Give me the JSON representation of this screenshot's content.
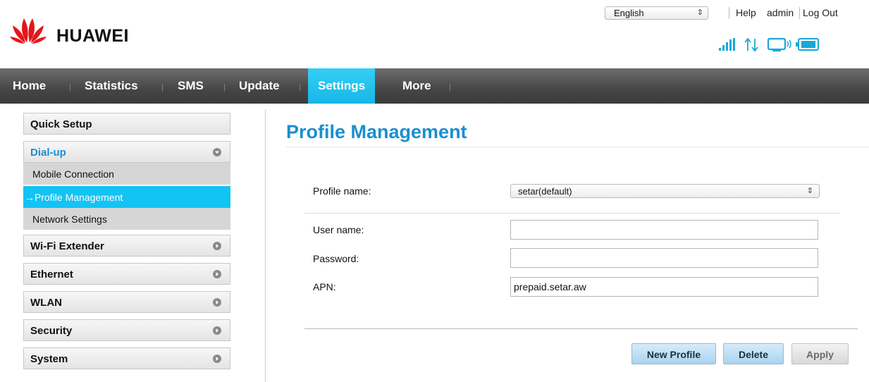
{
  "header": {
    "brand": "HUAWEI",
    "language": "English",
    "links": [
      "Help",
      "admin",
      "Log Out"
    ]
  },
  "icons": {
    "signal": "signal-strength-icon",
    "data": "data-transfer-arrows-icon",
    "wifi_device": "connected-device-icon",
    "battery": "battery-icon"
  },
  "nav": {
    "items": [
      "Home",
      "Statistics",
      "SMS",
      "Update",
      "Settings",
      "More"
    ],
    "active": "Settings"
  },
  "sidebar": {
    "quick_setup": "Quick Setup",
    "dialup": "Dial-up",
    "dialup_subitems": [
      "Mobile Connection",
      "→Profile Management",
      "Network Settings"
    ],
    "groups": [
      "Wi-Fi Extender",
      "Ethernet",
      "WLAN",
      "Security",
      "System"
    ]
  },
  "main": {
    "title": "Profile Management",
    "profile_name_label": "Profile name:",
    "profile_name_value": "setar(default)",
    "user_name_label": "User name:",
    "user_name_value": "",
    "password_label": "Password:",
    "password_value": "",
    "apn_label": "APN:",
    "apn_value": "prepaid.setar.aw"
  },
  "buttons": {
    "new_profile": "New Profile",
    "delete": "Delete",
    "apply": "Apply"
  },
  "colors": {
    "accent": "#18b6e6",
    "title": "#1a8fd0",
    "nav_bg": "#454545",
    "logo_red": "#e3161b"
  }
}
